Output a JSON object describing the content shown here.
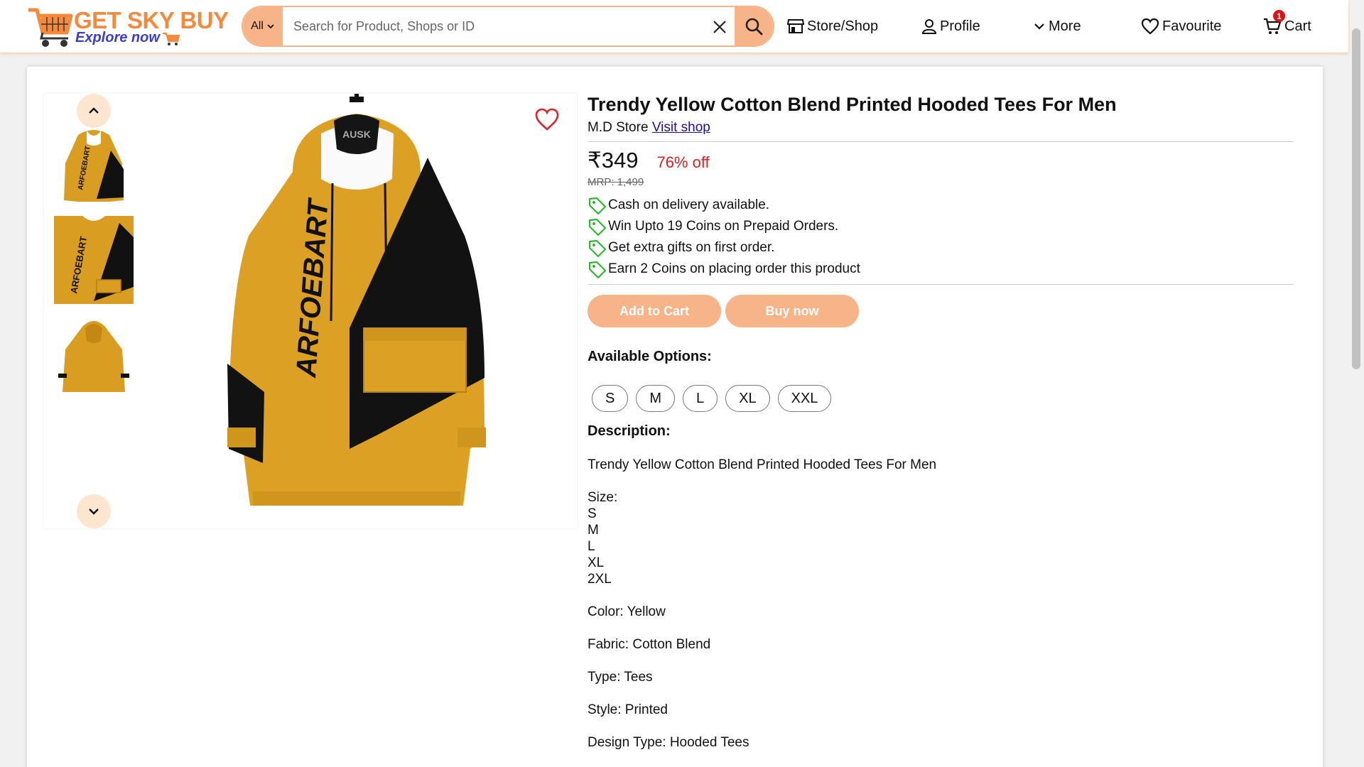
{
  "brand": {
    "name": "GET SKY BUY",
    "tagline": "Explore now",
    "accent": "#f8b489",
    "brand_orange": "#f58a3c",
    "tagline_color": "#3b3bd6"
  },
  "search": {
    "category": "All",
    "placeholder": "Search for Product, Shops or ID",
    "value": ""
  },
  "nav": {
    "store": "Store/Shop",
    "profile": "Profile",
    "more": "More",
    "favourite": "Favourite",
    "cart": "Cart",
    "cart_count": "1"
  },
  "product": {
    "title": "Trendy Yellow Cotton Blend Printed Hooded Tees For Men",
    "shop_name": "M.D Store",
    "visit_shop": "Visit shop",
    "price": "₹349",
    "discount": "76% off",
    "mrp": "MRP: 1,499",
    "offers": [
      "Cash on delivery available.",
      "Win Upto 19 Coins on Prepaid Orders.",
      "Get extra gifts on first order.",
      "Earn 2 Coins on placing order this product"
    ],
    "add_to_cart": "Add to Cart",
    "buy_now": "Buy now",
    "options_title": "Available Options:",
    "options": [
      "S",
      "M",
      "L",
      "XL",
      "XXL"
    ],
    "description_title": "Description:",
    "description_lines": [
      "Trendy Yellow Cotton Blend Printed Hooded Tees For Men",
      "Size:",
      "S",
      "M",
      "L",
      "XL",
      "2XL",
      "Color: Yellow",
      "Fabric: Cotton Blend",
      "Type: Tees",
      "Style: Printed",
      "Design Type: Hooded Tees"
    ],
    "image_print_text": "ARFOEBART",
    "hanger_text": "AUSK"
  }
}
